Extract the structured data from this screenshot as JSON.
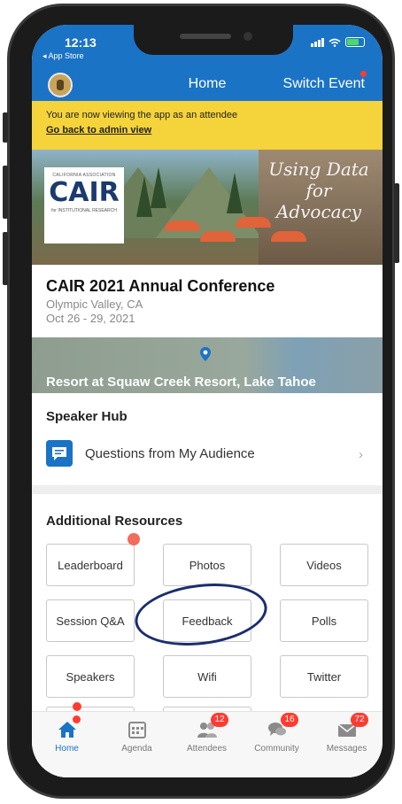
{
  "status": {
    "time": "12:13",
    "back_label": "◂ App Store"
  },
  "header": {
    "title": "Home",
    "switch_event": "Switch Event"
  },
  "banner": {
    "message": "You are now viewing the app as an attendee",
    "link": "Go back to admin view"
  },
  "hero": {
    "logo_top": "CALIFORNIA ASSOCIATION",
    "logo_main": "CAIR",
    "logo_bottom": "for INSTITUTIONAL RESEARCH",
    "script_text": "Using Data for Advocacy"
  },
  "event": {
    "title": "CAIR 2021 Annual Conference",
    "location": "Olympic Valley, CA",
    "dates": "Oct 26 - 29, 2021"
  },
  "map": {
    "venue": "Resort at Squaw Creek Resort, Lake Tahoe"
  },
  "speaker_hub": {
    "title": "Speaker Hub",
    "item": "Questions from My Audience"
  },
  "resources": {
    "title": "Additional Resources",
    "buttons": [
      "Leaderboard",
      "Photos",
      "Videos",
      "Session Q&A",
      "Feedback",
      "Polls",
      "Speakers",
      "Wifi",
      "Twitter"
    ]
  },
  "tabs": [
    {
      "label": "Home",
      "icon": "home-icon"
    },
    {
      "label": "Agenda",
      "icon": "calendar-icon"
    },
    {
      "label": "Attendees",
      "icon": "people-icon",
      "badge": "12"
    },
    {
      "label": "Community",
      "icon": "chat-icon",
      "badge": "16"
    },
    {
      "label": "Messages",
      "icon": "mail-icon",
      "badge": "72"
    }
  ],
  "colors": {
    "brand": "#1b73c6",
    "banner": "#f5d33a",
    "badge": "#ff3b30"
  }
}
